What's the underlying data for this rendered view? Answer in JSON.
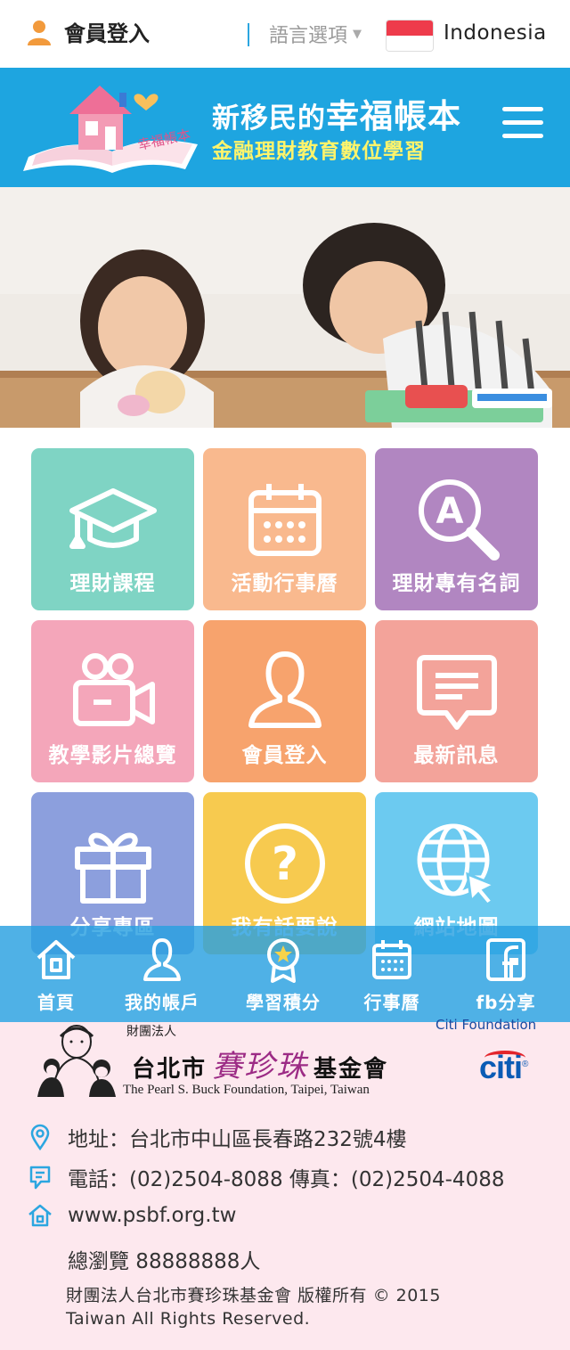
{
  "topbar": {
    "login_label": "會員登入",
    "language_label": "語言選項",
    "country": "Indonesia"
  },
  "header": {
    "logo_text": "幸福帳本",
    "title_prefix": "新移民的",
    "title_main": "幸福帳本",
    "subtitle": "金融理財教育數位學習"
  },
  "tiles": [
    {
      "label": "理財課程",
      "color": "#7fd4c4",
      "icon": "graduation-cap-icon"
    },
    {
      "label": "活動行事曆",
      "color": "#f9b98e",
      "icon": "calendar-icon"
    },
    {
      "label": "理財專有名詞",
      "color": "#b186c1",
      "icon": "search-letter-icon"
    },
    {
      "label": "教學影片總覽",
      "color": "#f4a6ba",
      "icon": "video-camera-icon"
    },
    {
      "label": "會員登入",
      "color": "#f7a36d",
      "icon": "person-icon"
    },
    {
      "label": "最新訊息",
      "color": "#f3a39a",
      "icon": "message-icon"
    },
    {
      "label": "分享專區",
      "color": "#8c9fdd",
      "icon": "gift-icon"
    },
    {
      "label": "我有話要說",
      "color": "#f7ca4f",
      "icon": "question-icon"
    },
    {
      "label": "網站地圖",
      "color": "#6ccaf0",
      "icon": "globe-icon"
    }
  ],
  "bottom_nav": [
    {
      "label": "首頁",
      "icon": "home-icon"
    },
    {
      "label": "我的帳戶",
      "icon": "user-icon"
    },
    {
      "label": "學習積分",
      "icon": "medal-icon"
    },
    {
      "label": "行事曆",
      "icon": "calendar-icon"
    },
    {
      "label": "fb分享",
      "icon": "facebook-icon"
    }
  ],
  "footer": {
    "org_prefix": "財團法人",
    "org_city": "台北市",
    "org_callig": "賽珍珠",
    "org_suffix": "基金會",
    "org_en": "The Pearl S. Buck Foundation, Taipei, Taiwan",
    "citi_foundation": "Citi Foundation",
    "citi_logo": "citi",
    "address": "地址：台北市中山區長春路232號4樓",
    "phone": "電話：(02)2504-8088   傳真：(02)2504-4088",
    "website": "www.psbf.org.tw",
    "visits": "總瀏覽 88888888人",
    "copyright_line1": "財團法人台北市賽珍珠基金會 版權所有 © 2015",
    "copyright_line2": "Taiwan All Rights Reserved."
  }
}
